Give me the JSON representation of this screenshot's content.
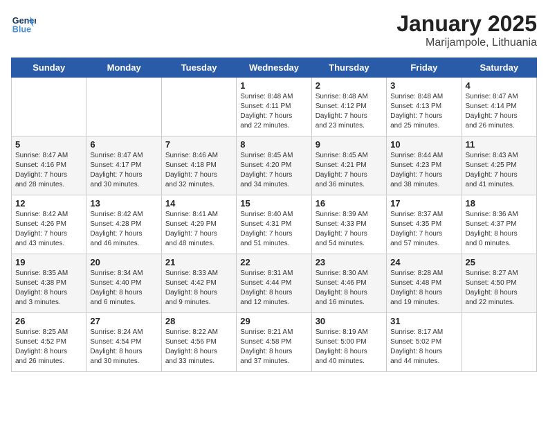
{
  "header": {
    "logo_line1": "General",
    "logo_line2": "Blue",
    "title": "January 2025",
    "subtitle": "Marijampole, Lithuania"
  },
  "weekdays": [
    "Sunday",
    "Monday",
    "Tuesday",
    "Wednesday",
    "Thursday",
    "Friday",
    "Saturday"
  ],
  "weeks": [
    [
      {
        "day": "",
        "info": ""
      },
      {
        "day": "",
        "info": ""
      },
      {
        "day": "",
        "info": ""
      },
      {
        "day": "1",
        "info": "Sunrise: 8:48 AM\nSunset: 4:11 PM\nDaylight: 7 hours\nand 22 minutes."
      },
      {
        "day": "2",
        "info": "Sunrise: 8:48 AM\nSunset: 4:12 PM\nDaylight: 7 hours\nand 23 minutes."
      },
      {
        "day": "3",
        "info": "Sunrise: 8:48 AM\nSunset: 4:13 PM\nDaylight: 7 hours\nand 25 minutes."
      },
      {
        "day": "4",
        "info": "Sunrise: 8:47 AM\nSunset: 4:14 PM\nDaylight: 7 hours\nand 26 minutes."
      }
    ],
    [
      {
        "day": "5",
        "info": "Sunrise: 8:47 AM\nSunset: 4:16 PM\nDaylight: 7 hours\nand 28 minutes."
      },
      {
        "day": "6",
        "info": "Sunrise: 8:47 AM\nSunset: 4:17 PM\nDaylight: 7 hours\nand 30 minutes."
      },
      {
        "day": "7",
        "info": "Sunrise: 8:46 AM\nSunset: 4:18 PM\nDaylight: 7 hours\nand 32 minutes."
      },
      {
        "day": "8",
        "info": "Sunrise: 8:45 AM\nSunset: 4:20 PM\nDaylight: 7 hours\nand 34 minutes."
      },
      {
        "day": "9",
        "info": "Sunrise: 8:45 AM\nSunset: 4:21 PM\nDaylight: 7 hours\nand 36 minutes."
      },
      {
        "day": "10",
        "info": "Sunrise: 8:44 AM\nSunset: 4:23 PM\nDaylight: 7 hours\nand 38 minutes."
      },
      {
        "day": "11",
        "info": "Sunrise: 8:43 AM\nSunset: 4:25 PM\nDaylight: 7 hours\nand 41 minutes."
      }
    ],
    [
      {
        "day": "12",
        "info": "Sunrise: 8:42 AM\nSunset: 4:26 PM\nDaylight: 7 hours\nand 43 minutes."
      },
      {
        "day": "13",
        "info": "Sunrise: 8:42 AM\nSunset: 4:28 PM\nDaylight: 7 hours\nand 46 minutes."
      },
      {
        "day": "14",
        "info": "Sunrise: 8:41 AM\nSunset: 4:29 PM\nDaylight: 7 hours\nand 48 minutes."
      },
      {
        "day": "15",
        "info": "Sunrise: 8:40 AM\nSunset: 4:31 PM\nDaylight: 7 hours\nand 51 minutes."
      },
      {
        "day": "16",
        "info": "Sunrise: 8:39 AM\nSunset: 4:33 PM\nDaylight: 7 hours\nand 54 minutes."
      },
      {
        "day": "17",
        "info": "Sunrise: 8:37 AM\nSunset: 4:35 PM\nDaylight: 7 hours\nand 57 minutes."
      },
      {
        "day": "18",
        "info": "Sunrise: 8:36 AM\nSunset: 4:37 PM\nDaylight: 8 hours\nand 0 minutes."
      }
    ],
    [
      {
        "day": "19",
        "info": "Sunrise: 8:35 AM\nSunset: 4:38 PM\nDaylight: 8 hours\nand 3 minutes."
      },
      {
        "day": "20",
        "info": "Sunrise: 8:34 AM\nSunset: 4:40 PM\nDaylight: 8 hours\nand 6 minutes."
      },
      {
        "day": "21",
        "info": "Sunrise: 8:33 AM\nSunset: 4:42 PM\nDaylight: 8 hours\nand 9 minutes."
      },
      {
        "day": "22",
        "info": "Sunrise: 8:31 AM\nSunset: 4:44 PM\nDaylight: 8 hours\nand 12 minutes."
      },
      {
        "day": "23",
        "info": "Sunrise: 8:30 AM\nSunset: 4:46 PM\nDaylight: 8 hours\nand 16 minutes."
      },
      {
        "day": "24",
        "info": "Sunrise: 8:28 AM\nSunset: 4:48 PM\nDaylight: 8 hours\nand 19 minutes."
      },
      {
        "day": "25",
        "info": "Sunrise: 8:27 AM\nSunset: 4:50 PM\nDaylight: 8 hours\nand 22 minutes."
      }
    ],
    [
      {
        "day": "26",
        "info": "Sunrise: 8:25 AM\nSunset: 4:52 PM\nDaylight: 8 hours\nand 26 minutes."
      },
      {
        "day": "27",
        "info": "Sunrise: 8:24 AM\nSunset: 4:54 PM\nDaylight: 8 hours\nand 30 minutes."
      },
      {
        "day": "28",
        "info": "Sunrise: 8:22 AM\nSunset: 4:56 PM\nDaylight: 8 hours\nand 33 minutes."
      },
      {
        "day": "29",
        "info": "Sunrise: 8:21 AM\nSunset: 4:58 PM\nDaylight: 8 hours\nand 37 minutes."
      },
      {
        "day": "30",
        "info": "Sunrise: 8:19 AM\nSunset: 5:00 PM\nDaylight: 8 hours\nand 40 minutes."
      },
      {
        "day": "31",
        "info": "Sunrise: 8:17 AM\nSunset: 5:02 PM\nDaylight: 8 hours\nand 44 minutes."
      },
      {
        "day": "",
        "info": ""
      }
    ]
  ]
}
